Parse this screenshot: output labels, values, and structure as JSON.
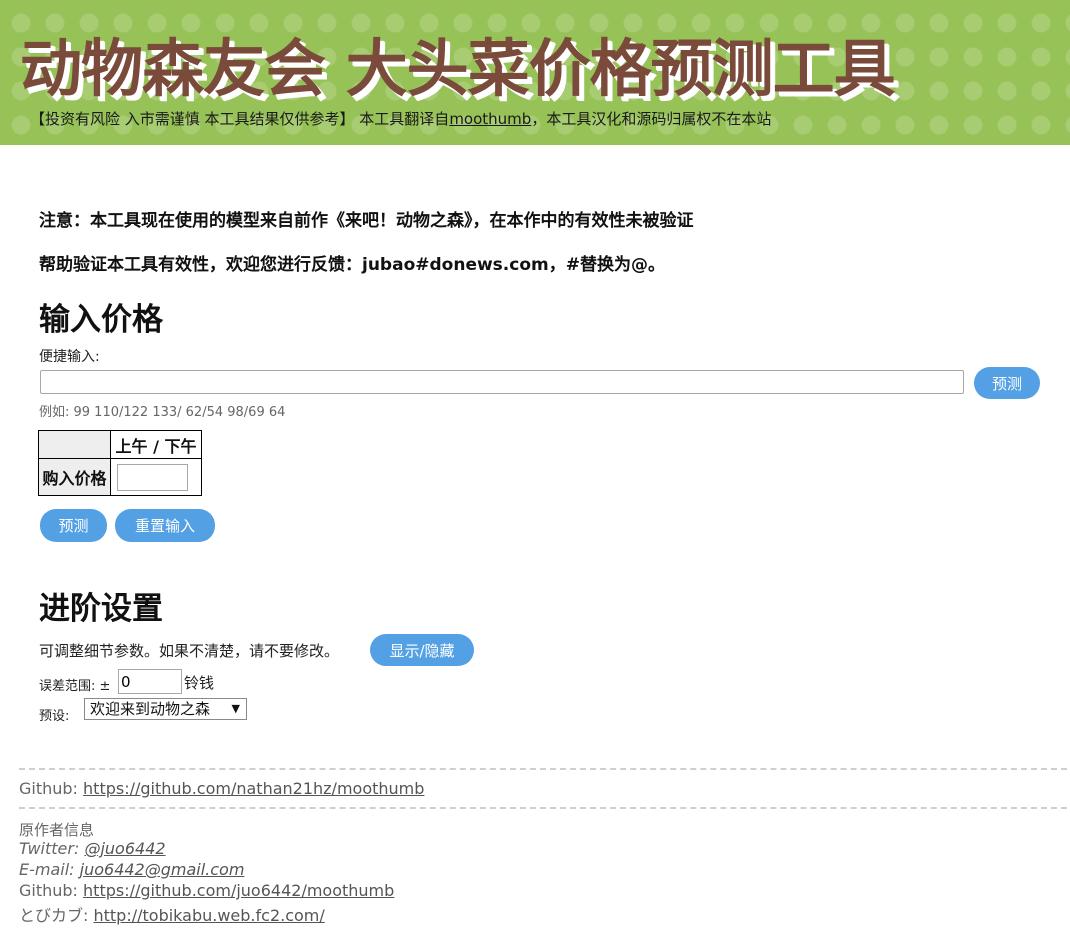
{
  "header": {
    "title": "动物森友会 大头菜价格预测工具",
    "subtitle_prefix": "【投资有风险 入市需谨慎 本工具结果仅供参考】 本工具翻译自",
    "subtitle_link": "moothumb",
    "subtitle_suffix": "，本工具汉化和源码归属权不在本站"
  },
  "notices": {
    "line1": "注意：本工具现在使用的模型来自前作《来吧！动物之森》，在本作中的有效性未被验证",
    "line2": "帮助验证本工具有效性，欢迎您进行反馈：jubao#donews.com，#替换为@。"
  },
  "input_section": {
    "heading": "输入价格",
    "quick_label": "便捷输入:",
    "quick_value": "",
    "predict_label": "预测",
    "example": "例如: 99 110/122 133/ 62/54 98/69 64",
    "table": {
      "col_header": "上午 / 下午",
      "row_header": "购入价格",
      "price_value": ""
    },
    "predict_button": "预测",
    "reset_button": "重置输入"
  },
  "advanced": {
    "heading": "进阶设置",
    "desc": "可调整细节参数。如果不清楚，请不要修改。",
    "toggle_button": "显示/隐藏",
    "error_label": "误差范围: ±",
    "error_value": "0",
    "error_unit": "铃钱",
    "preset_label": "预设:",
    "preset_value": "欢迎来到动物之森"
  },
  "footer": {
    "github_label": "Github: ",
    "github_link": "https://github.com/nathan21hz/moothumb",
    "author_heading": "原作者信息",
    "twitter_label": "Twitter: ",
    "twitter_link": "@juo6442",
    "email_label": "E-mail: ",
    "email_link": "juo6442@gmail.com",
    "author_github_label": "Github: ",
    "author_github_link": "https://github.com/juo6442/moothumb",
    "tobikabu_label": "とびカブ: ",
    "tobikabu_link": "http://tobikabu.web.fc2.com/"
  },
  "colors": {
    "header_bg": "#96c257",
    "title": "#7a4a3a",
    "button": "#54a0e4"
  }
}
